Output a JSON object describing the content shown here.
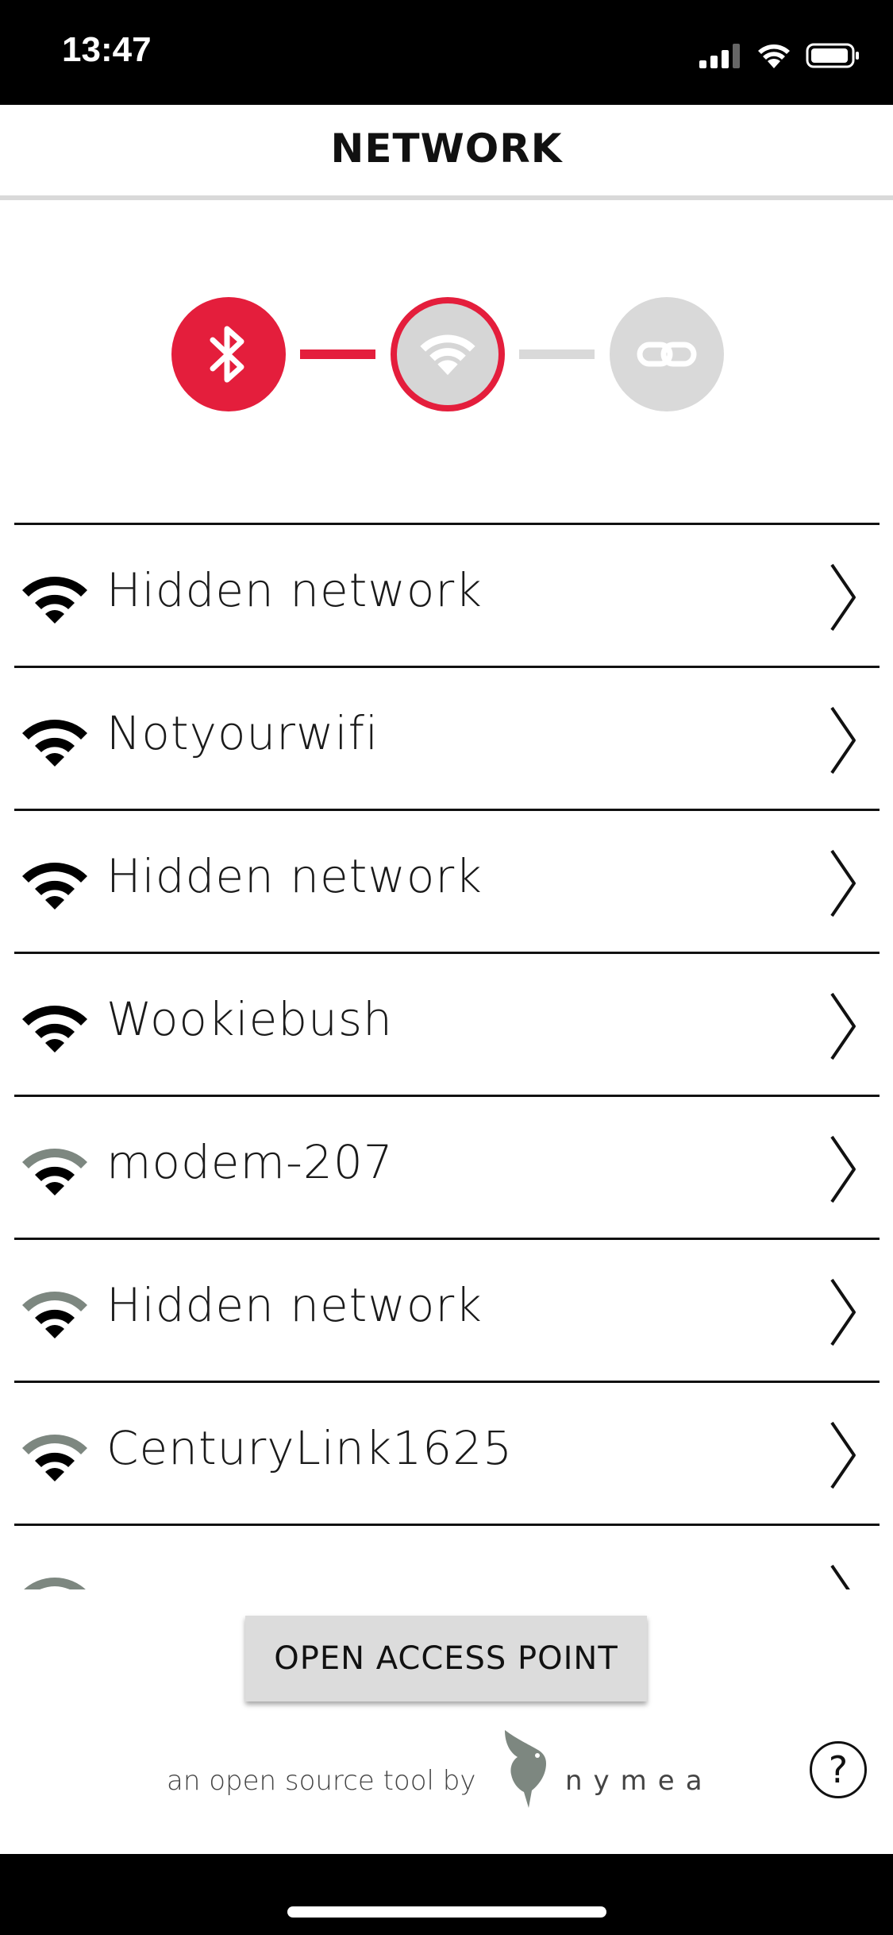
{
  "status_bar": {
    "time": "13:47",
    "signal_icon": "cellular-signal-icon",
    "wifi_icon": "wifi-icon",
    "battery_icon": "battery-icon"
  },
  "header": {
    "title": "NETWORK"
  },
  "colors": {
    "accent": "#e41e3c",
    "inactive": "#d9d9d9",
    "weak_signal": "#7d8780"
  },
  "stepper": {
    "steps": [
      {
        "icon": "bluetooth-icon",
        "state": "done"
      },
      {
        "icon": "wifi-icon",
        "state": "current"
      },
      {
        "icon": "link-icon",
        "state": "pending"
      }
    ]
  },
  "networks": [
    {
      "name": "Hidden network",
      "signal": "strong"
    },
    {
      "name": "Notyourwifi",
      "signal": "strong"
    },
    {
      "name": "Hidden network",
      "signal": "strong"
    },
    {
      "name": "Wookiebush",
      "signal": "strong"
    },
    {
      "name": "modem-207",
      "signal": "medium"
    },
    {
      "name": "Hidden network",
      "signal": "medium"
    },
    {
      "name": "CenturyLink1625",
      "signal": "medium"
    },
    {
      "name": "",
      "signal": "medium"
    }
  ],
  "actions": {
    "open_access_point": "OPEN ACCESS POINT"
  },
  "footer": {
    "tagline": "an open source tool by",
    "brand": "nymea",
    "help": "?"
  }
}
